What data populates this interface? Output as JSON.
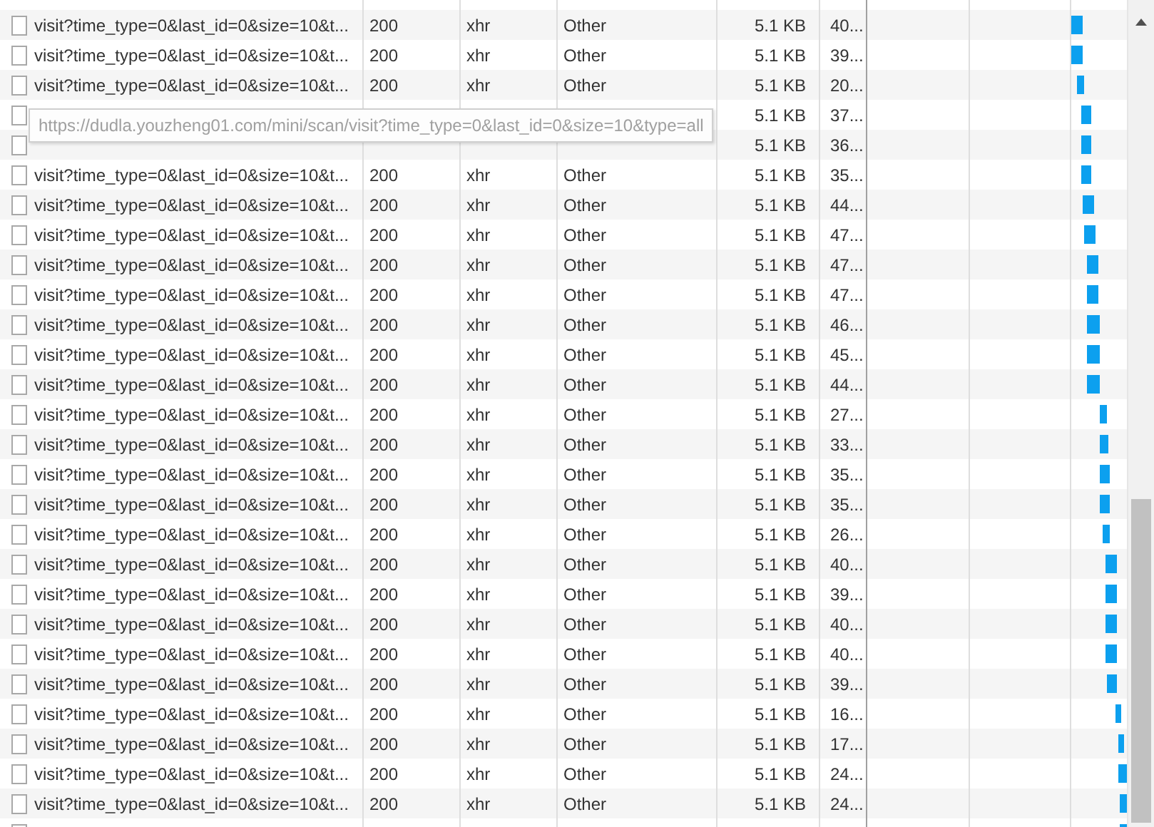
{
  "requests": [
    {
      "name": "visit?time_type=0&last_id=0&size=10&t...",
      "status": "200",
      "type": "xhr",
      "initiator": "Other",
      "size": "5.1 KB",
      "time": "40..."
    },
    {
      "name": "visit?time_type=0&last_id=0&size=10&t...",
      "status": "200",
      "type": "xhr",
      "initiator": "Other",
      "size": "5.1 KB",
      "time": "39..."
    },
    {
      "name": "visit?time_type=0&last_id=0&size=10&t...",
      "status": "200",
      "type": "xhr",
      "initiator": "Other",
      "size": "5.1 KB",
      "time": "20..."
    },
    {
      "size": "5.1 KB",
      "time": "37..."
    },
    {
      "size": "5.1 KB",
      "time": "36..."
    },
    {
      "name": "visit?time_type=0&last_id=0&size=10&t...",
      "status": "200",
      "type": "xhr",
      "initiator": "Other",
      "size": "5.1 KB",
      "time": "35..."
    },
    {
      "name": "visit?time_type=0&last_id=0&size=10&t...",
      "status": "200",
      "type": "xhr",
      "initiator": "Other",
      "size": "5.1 KB",
      "time": "44..."
    },
    {
      "name": "visit?time_type=0&last_id=0&size=10&t...",
      "status": "200",
      "type": "xhr",
      "initiator": "Other",
      "size": "5.1 KB",
      "time": "47..."
    },
    {
      "name": "visit?time_type=0&last_id=0&size=10&t...",
      "status": "200",
      "type": "xhr",
      "initiator": "Other",
      "size": "5.1 KB",
      "time": "47..."
    },
    {
      "name": "visit?time_type=0&last_id=0&size=10&t...",
      "status": "200",
      "type": "xhr",
      "initiator": "Other",
      "size": "5.1 KB",
      "time": "47..."
    },
    {
      "name": "visit?time_type=0&last_id=0&size=10&t...",
      "status": "200",
      "type": "xhr",
      "initiator": "Other",
      "size": "5.1 KB",
      "time": "46..."
    },
    {
      "name": "visit?time_type=0&last_id=0&size=10&t...",
      "status": "200",
      "type": "xhr",
      "initiator": "Other",
      "size": "5.1 KB",
      "time": "45..."
    },
    {
      "name": "visit?time_type=0&last_id=0&size=10&t...",
      "status": "200",
      "type": "xhr",
      "initiator": "Other",
      "size": "5.1 KB",
      "time": "44..."
    },
    {
      "name": "visit?time_type=0&last_id=0&size=10&t...",
      "status": "200",
      "type": "xhr",
      "initiator": "Other",
      "size": "5.1 KB",
      "time": "27..."
    },
    {
      "name": "visit?time_type=0&last_id=0&size=10&t...",
      "status": "200",
      "type": "xhr",
      "initiator": "Other",
      "size": "5.1 KB",
      "time": "33..."
    },
    {
      "name": "visit?time_type=0&last_id=0&size=10&t...",
      "status": "200",
      "type": "xhr",
      "initiator": "Other",
      "size": "5.1 KB",
      "time": "35..."
    },
    {
      "name": "visit?time_type=0&last_id=0&size=10&t...",
      "status": "200",
      "type": "xhr",
      "initiator": "Other",
      "size": "5.1 KB",
      "time": "35..."
    },
    {
      "name": "visit?time_type=0&last_id=0&size=10&t...",
      "status": "200",
      "type": "xhr",
      "initiator": "Other",
      "size": "5.1 KB",
      "time": "26..."
    },
    {
      "name": "visit?time_type=0&last_id=0&size=10&t...",
      "status": "200",
      "type": "xhr",
      "initiator": "Other",
      "size": "5.1 KB",
      "time": "40..."
    },
    {
      "name": "visit?time_type=0&last_id=0&size=10&t...",
      "status": "200",
      "type": "xhr",
      "initiator": "Other",
      "size": "5.1 KB",
      "time": "39..."
    },
    {
      "name": "visit?time_type=0&last_id=0&size=10&t...",
      "status": "200",
      "type": "xhr",
      "initiator": "Other",
      "size": "5.1 KB",
      "time": "40..."
    },
    {
      "name": "visit?time_type=0&last_id=0&size=10&t...",
      "status": "200",
      "type": "xhr",
      "initiator": "Other",
      "size": "5.1 KB",
      "time": "40..."
    },
    {
      "name": "visit?time_type=0&last_id=0&size=10&t...",
      "status": "200",
      "type": "xhr",
      "initiator": "Other",
      "size": "5.1 KB",
      "time": "39..."
    },
    {
      "name": "visit?time_type=0&last_id=0&size=10&t...",
      "status": "200",
      "type": "xhr",
      "initiator": "Other",
      "size": "5.1 KB",
      "time": "16..."
    },
    {
      "name": "visit?time_type=0&last_id=0&size=10&t...",
      "status": "200",
      "type": "xhr",
      "initiator": "Other",
      "size": "5.1 KB",
      "time": "17..."
    },
    {
      "name": "visit?time_type=0&last_id=0&size=10&t...",
      "status": "200",
      "type": "xhr",
      "initiator": "Other",
      "size": "5.1 KB",
      "time": "24..."
    },
    {
      "name": "visit?time_type=0&last_id=0&size=10&t...",
      "status": "200",
      "type": "xhr",
      "initiator": "Other",
      "size": "5.1 KB",
      "time": "24..."
    }
  ],
  "tooltip": "https://dudla.youzheng01.com/mini/scan/visit?time_type=0&last_id=0&size=10&type=all"
}
